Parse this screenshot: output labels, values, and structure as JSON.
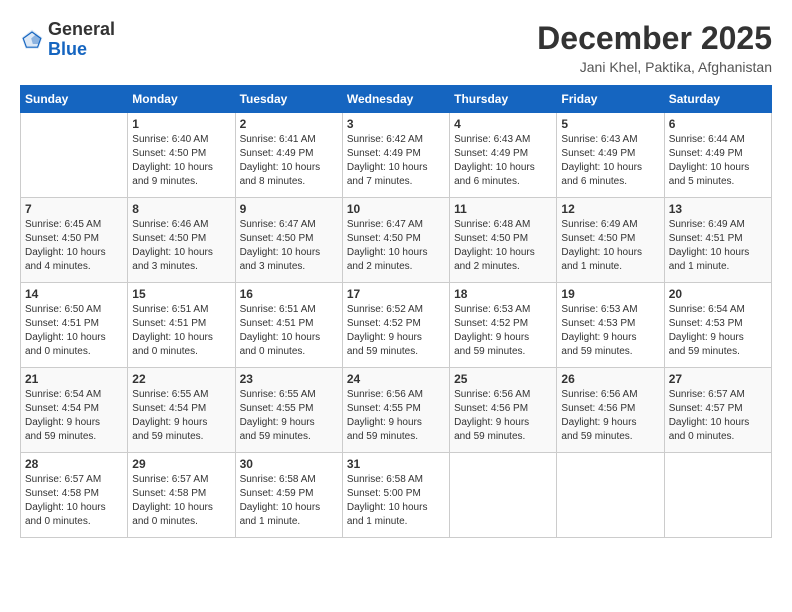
{
  "header": {
    "logo_general": "General",
    "logo_blue": "Blue",
    "month_title": "December 2025",
    "location": "Jani Khel, Paktika, Afghanistan"
  },
  "calendar": {
    "days_of_week": [
      "Sunday",
      "Monday",
      "Tuesday",
      "Wednesday",
      "Thursday",
      "Friday",
      "Saturday"
    ],
    "weeks": [
      [
        {
          "day": "",
          "info": ""
        },
        {
          "day": "1",
          "info": "Sunrise: 6:40 AM\nSunset: 4:50 PM\nDaylight: 10 hours\nand 9 minutes."
        },
        {
          "day": "2",
          "info": "Sunrise: 6:41 AM\nSunset: 4:49 PM\nDaylight: 10 hours\nand 8 minutes."
        },
        {
          "day": "3",
          "info": "Sunrise: 6:42 AM\nSunset: 4:49 PM\nDaylight: 10 hours\nand 7 minutes."
        },
        {
          "day": "4",
          "info": "Sunrise: 6:43 AM\nSunset: 4:49 PM\nDaylight: 10 hours\nand 6 minutes."
        },
        {
          "day": "5",
          "info": "Sunrise: 6:43 AM\nSunset: 4:49 PM\nDaylight: 10 hours\nand 6 minutes."
        },
        {
          "day": "6",
          "info": "Sunrise: 6:44 AM\nSunset: 4:49 PM\nDaylight: 10 hours\nand 5 minutes."
        }
      ],
      [
        {
          "day": "7",
          "info": "Sunrise: 6:45 AM\nSunset: 4:50 PM\nDaylight: 10 hours\nand 4 minutes."
        },
        {
          "day": "8",
          "info": "Sunrise: 6:46 AM\nSunset: 4:50 PM\nDaylight: 10 hours\nand 3 minutes."
        },
        {
          "day": "9",
          "info": "Sunrise: 6:47 AM\nSunset: 4:50 PM\nDaylight: 10 hours\nand 3 minutes."
        },
        {
          "day": "10",
          "info": "Sunrise: 6:47 AM\nSunset: 4:50 PM\nDaylight: 10 hours\nand 2 minutes."
        },
        {
          "day": "11",
          "info": "Sunrise: 6:48 AM\nSunset: 4:50 PM\nDaylight: 10 hours\nand 2 minutes."
        },
        {
          "day": "12",
          "info": "Sunrise: 6:49 AM\nSunset: 4:50 PM\nDaylight: 10 hours\nand 1 minute."
        },
        {
          "day": "13",
          "info": "Sunrise: 6:49 AM\nSunset: 4:51 PM\nDaylight: 10 hours\nand 1 minute."
        }
      ],
      [
        {
          "day": "14",
          "info": "Sunrise: 6:50 AM\nSunset: 4:51 PM\nDaylight: 10 hours\nand 0 minutes."
        },
        {
          "day": "15",
          "info": "Sunrise: 6:51 AM\nSunset: 4:51 PM\nDaylight: 10 hours\nand 0 minutes."
        },
        {
          "day": "16",
          "info": "Sunrise: 6:51 AM\nSunset: 4:51 PM\nDaylight: 10 hours\nand 0 minutes."
        },
        {
          "day": "17",
          "info": "Sunrise: 6:52 AM\nSunset: 4:52 PM\nDaylight: 9 hours\nand 59 minutes."
        },
        {
          "day": "18",
          "info": "Sunrise: 6:53 AM\nSunset: 4:52 PM\nDaylight: 9 hours\nand 59 minutes."
        },
        {
          "day": "19",
          "info": "Sunrise: 6:53 AM\nSunset: 4:53 PM\nDaylight: 9 hours\nand 59 minutes."
        },
        {
          "day": "20",
          "info": "Sunrise: 6:54 AM\nSunset: 4:53 PM\nDaylight: 9 hours\nand 59 minutes."
        }
      ],
      [
        {
          "day": "21",
          "info": "Sunrise: 6:54 AM\nSunset: 4:54 PM\nDaylight: 9 hours\nand 59 minutes."
        },
        {
          "day": "22",
          "info": "Sunrise: 6:55 AM\nSunset: 4:54 PM\nDaylight: 9 hours\nand 59 minutes."
        },
        {
          "day": "23",
          "info": "Sunrise: 6:55 AM\nSunset: 4:55 PM\nDaylight: 9 hours\nand 59 minutes."
        },
        {
          "day": "24",
          "info": "Sunrise: 6:56 AM\nSunset: 4:55 PM\nDaylight: 9 hours\nand 59 minutes."
        },
        {
          "day": "25",
          "info": "Sunrise: 6:56 AM\nSunset: 4:56 PM\nDaylight: 9 hours\nand 59 minutes."
        },
        {
          "day": "26",
          "info": "Sunrise: 6:56 AM\nSunset: 4:56 PM\nDaylight: 9 hours\nand 59 minutes."
        },
        {
          "day": "27",
          "info": "Sunrise: 6:57 AM\nSunset: 4:57 PM\nDaylight: 10 hours\nand 0 minutes."
        }
      ],
      [
        {
          "day": "28",
          "info": "Sunrise: 6:57 AM\nSunset: 4:58 PM\nDaylight: 10 hours\nand 0 minutes."
        },
        {
          "day": "29",
          "info": "Sunrise: 6:57 AM\nSunset: 4:58 PM\nDaylight: 10 hours\nand 0 minutes."
        },
        {
          "day": "30",
          "info": "Sunrise: 6:58 AM\nSunset: 4:59 PM\nDaylight: 10 hours\nand 1 minute."
        },
        {
          "day": "31",
          "info": "Sunrise: 6:58 AM\nSunset: 5:00 PM\nDaylight: 10 hours\nand 1 minute."
        },
        {
          "day": "",
          "info": ""
        },
        {
          "day": "",
          "info": ""
        },
        {
          "day": "",
          "info": ""
        }
      ]
    ]
  }
}
